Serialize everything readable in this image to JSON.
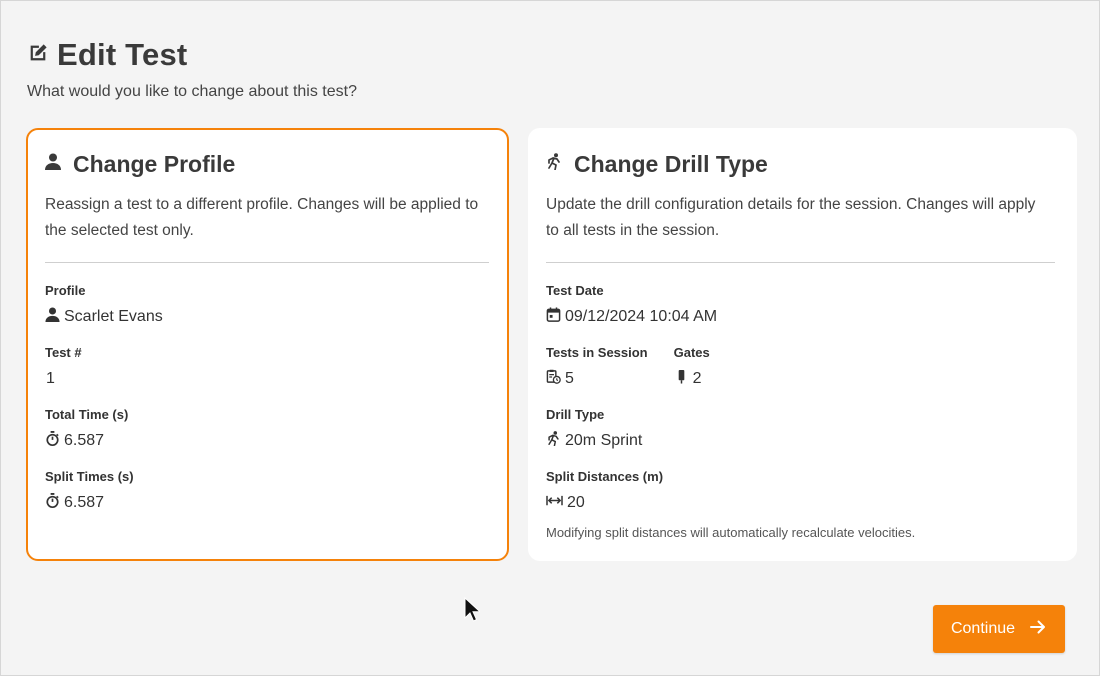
{
  "header": {
    "title": "Edit Test",
    "subtitle": "What would you like to change about this test?"
  },
  "profile_card": {
    "title": "Change Profile",
    "description": "Reassign a test to a different profile. Changes will be applied to the selected test only.",
    "fields": {
      "profile_label": "Profile",
      "profile_value": "Scarlet Evans",
      "test_num_label": "Test #",
      "test_num_value": "1",
      "total_time_label": "Total Time (s)",
      "total_time_value": "6.587",
      "split_times_label": "Split Times (s)",
      "split_times_value": "6.587"
    },
    "selected": true
  },
  "drill_card": {
    "title": "Change Drill Type",
    "description": "Update the drill configuration details for the session. Changes will apply to all tests in the session.",
    "fields": {
      "test_date_label": "Test Date",
      "test_date_value": "09/12/2024 10:04 AM",
      "tests_in_session_label": "Tests in Session",
      "tests_in_session_value": "5",
      "gates_label": "Gates",
      "gates_value": "2",
      "drill_type_label": "Drill Type",
      "drill_type_value": "20m Sprint",
      "split_distances_label": "Split Distances (m)",
      "split_distances_value": "20"
    },
    "note": "Modifying split distances will automatically recalculate velocities."
  },
  "footer": {
    "continue_label": "Continue"
  },
  "colors": {
    "accent": "#f5820a",
    "background": "#f4f4f4",
    "card": "#ffffff"
  },
  "icons": [
    "edit-icon",
    "person-icon",
    "runner-icon",
    "calendar-icon",
    "clipboard-clock-icon",
    "gate-icon",
    "stopwatch-icon",
    "width-arrows-icon",
    "arrow-right-icon",
    "mouse-cursor-icon"
  ]
}
